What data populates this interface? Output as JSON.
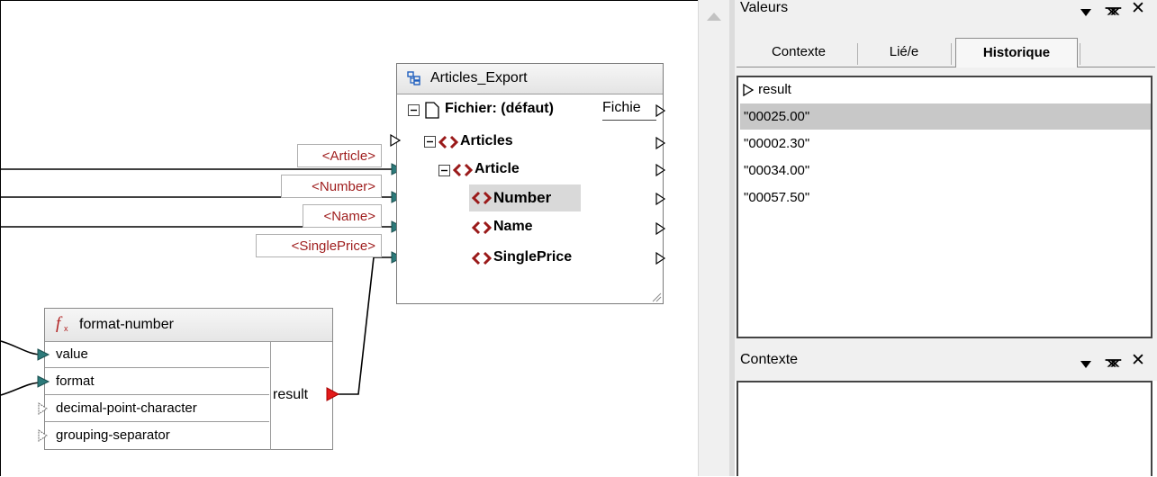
{
  "mapping": {
    "target_component": {
      "title": "Articles_Export",
      "file_label": "Fichier: (défaut)",
      "file_button": "Fichie",
      "nodes": [
        "Articles",
        "Article",
        "Number",
        "Name",
        "SinglePrice"
      ],
      "selected_node": "Number"
    },
    "tags": [
      "<Article>",
      "<Number>",
      "<Name>",
      "<SinglePrice>"
    ],
    "function": {
      "name": "format-number",
      "inputs": [
        "value",
        "format",
        "decimal-point-character",
        "grouping-separator"
      ],
      "output": "result"
    }
  },
  "values_panel": {
    "title": "Valeurs",
    "tabs": [
      "Contexte",
      "Lié/e",
      "Historique"
    ],
    "active_tab": "Historique",
    "header": "result",
    "values": [
      "\"00025.00\"",
      "\"00002.30\"",
      "\"00034.00\"",
      "\"00057.50\""
    ],
    "selected_index": 0
  },
  "context_panel": {
    "title": "Contexte"
  },
  "icons": [
    "element-icon",
    "file-icon",
    "function-icon",
    "component-icon",
    "pin-icon",
    "close-icon",
    "dropdown-icon",
    "connector-arrow-icon"
  ]
}
